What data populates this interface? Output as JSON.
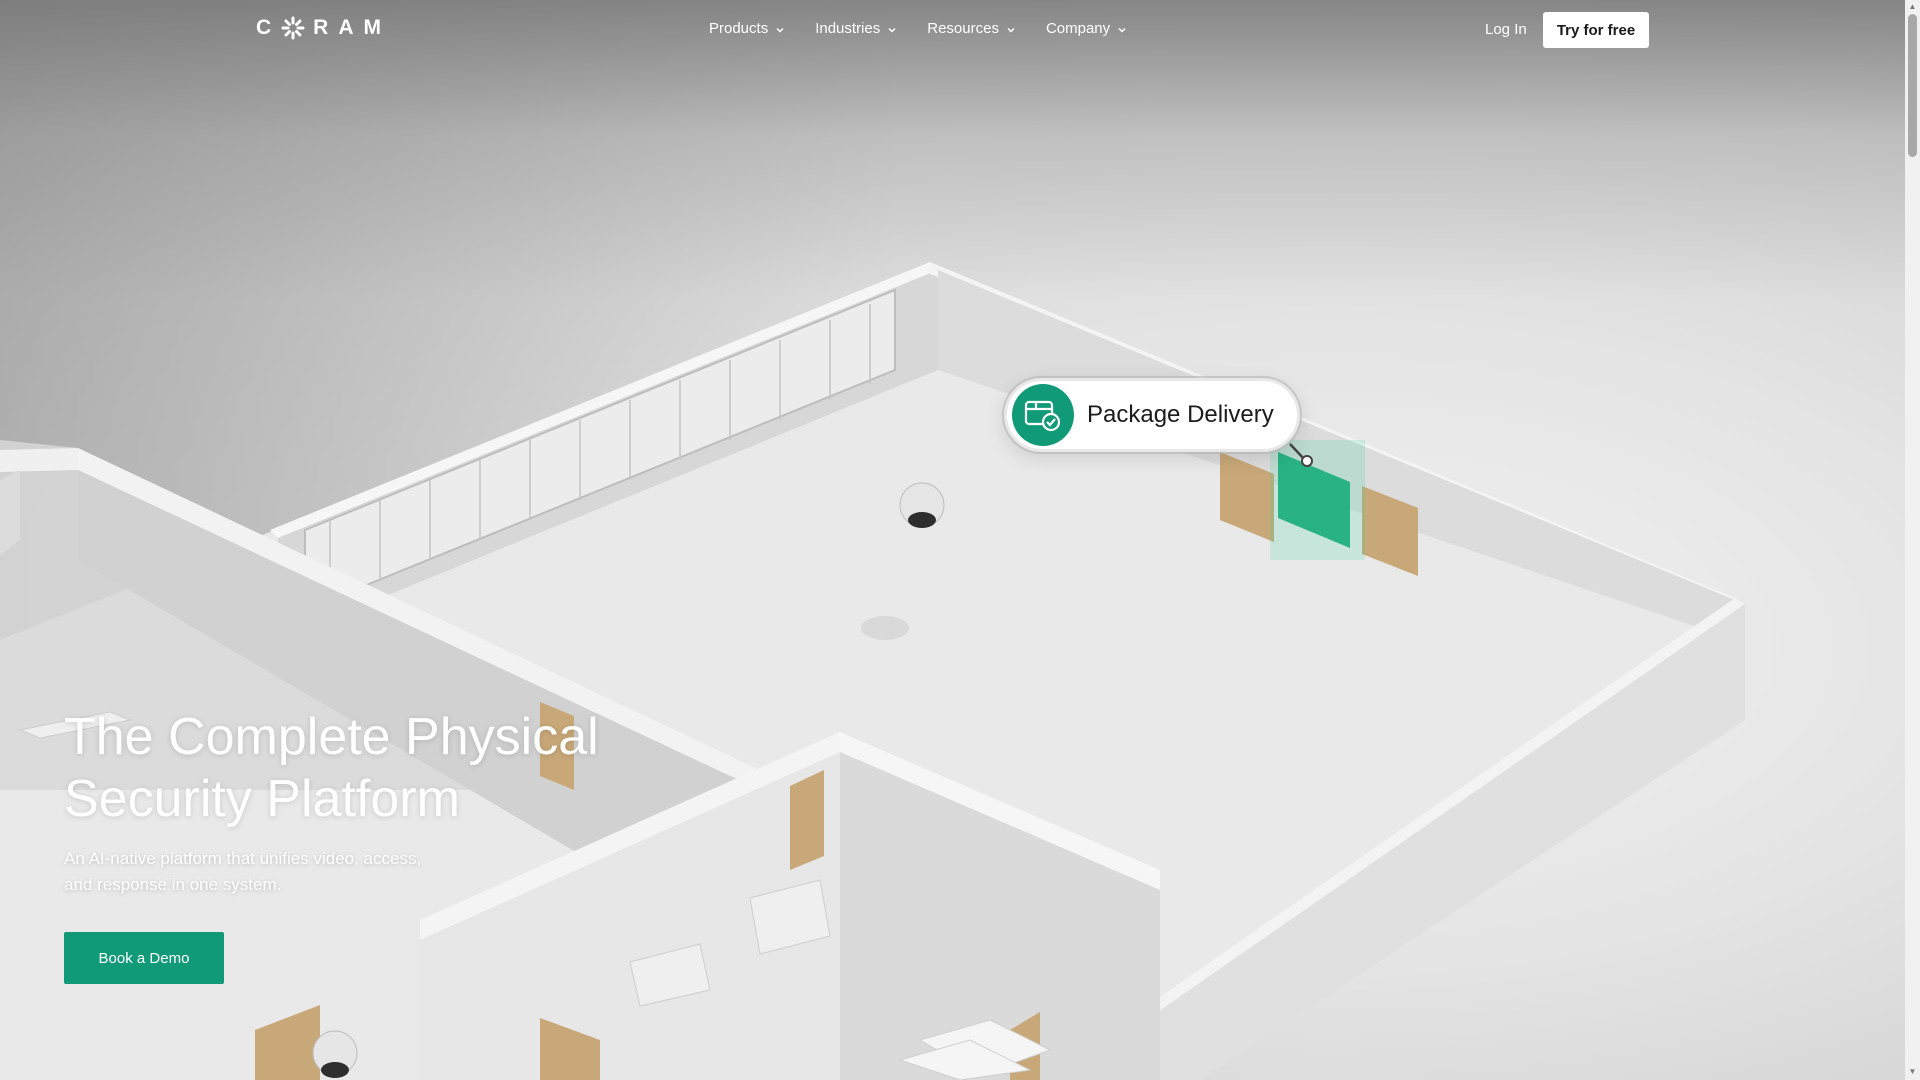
{
  "nav": {
    "logo_letters": [
      "C",
      "R",
      "A",
      "M"
    ],
    "links": [
      {
        "label": "Products",
        "name": "nav-products"
      },
      {
        "label": "Industries",
        "name": "nav-industries"
      },
      {
        "label": "Resources",
        "name": "nav-resources"
      },
      {
        "label": "Company",
        "name": "nav-company"
      }
    ],
    "login_label": "Log In",
    "cta_label": "Try for free"
  },
  "hero": {
    "title_line1": "The Complete Physical",
    "title_line2": "Security Platform",
    "subtitle_line1": "An AI-native platform that unifies video, access,",
    "subtitle_line2": "and response in one system.",
    "cta_label": "Book a Demo"
  },
  "scene": {
    "label": "Package Delivery",
    "label_icon": "package-check-icon"
  },
  "colors": {
    "accent": "#119a78",
    "door_highlight": "#1fa879",
    "door_wood": "#c8a878"
  }
}
